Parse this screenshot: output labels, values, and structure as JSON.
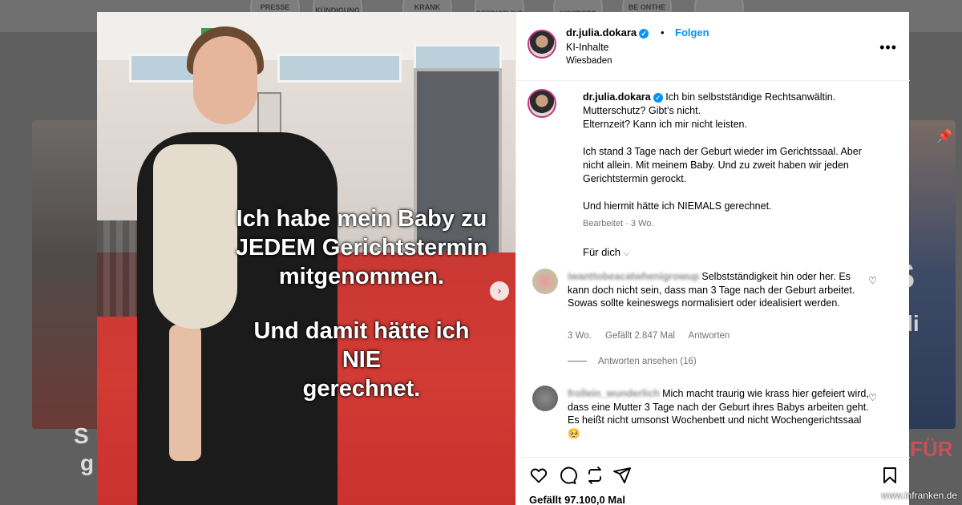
{
  "background": {
    "tiles": [
      "PRESSE",
      "KÜNDIGUNG",
      "KRANK",
      "BEFRISTUNG",
      "MINITIPPS",
      "BE ONTHE"
    ],
    "left_text": [
      "S",
      "g"
    ],
    "right_text": [
      "S",
      "uli"
    ],
    "right_overlay": "F FÜR"
  },
  "post": {
    "overlay_lines_1": [
      "Ich habe mein Baby zu",
      "JEDEM Gerichtstermin",
      "mitgenommen."
    ],
    "overlay_lines_2": [
      "Und damit hätte ich",
      "NIE",
      "gerechnet."
    ],
    "header": {
      "username": "dr.julia.dokara",
      "follow_label": "Folgen",
      "label": "KI-Inhalte",
      "location": "Wiesbaden"
    },
    "caption": {
      "username": "dr.julia.dokara",
      "line1": "Ich bin selbstständige Rechtsanwältin.",
      "line2": "Mutterschutz? Gibt’s nicht.",
      "line3": "Elternzeit? Kann ich mir nicht leisten.",
      "line4": "Ich stand 3 Tage nach der Geburt wieder im Gerichtssaal. Aber nicht allein. Mit meinem Baby. Und zu zweit haben wir jeden Gerichtstermin gerockt.",
      "line5": "Und hiermit hätte ich NIEMALS gerechnet.",
      "meta": "Bearbeitet · 3 Wo."
    },
    "for_you": "Für dich",
    "comments": [
      {
        "username": "iwanttobeacatwhenigrowup",
        "text": "Selbstständigkeit hin oder her. Es kann doch nicht sein, dass man 3 Tage nach der Geburt arbeitet. Sowas sollte keineswegs normalisiert oder idealisiert werden.",
        "age": "3 Wo.",
        "likes": "Gefällt 2.847 Mal",
        "reply": "Antworten",
        "view_replies": "Antworten ansehen (16)"
      },
      {
        "username": "frollein_wunderlich",
        "text": "Mich macht traurig wie krass hier gefeiert wird, dass eine Mutter 3 Tage nach der Geburt ihres Babys arbeiten geht.",
        "text2": "Es heißt nicht umsonst Wochenbett und nicht Wochengerichtssaal 🥺"
      }
    ],
    "likes": "Gefällt 97.100,0 Mal"
  },
  "watermark": "www.infranken.de"
}
